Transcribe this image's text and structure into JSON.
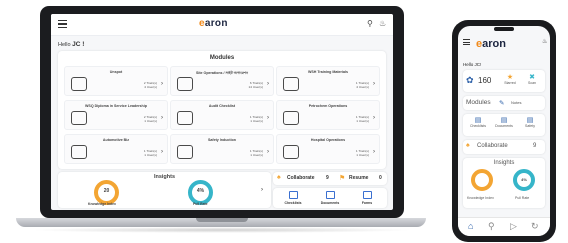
{
  "app": {
    "logo_text": "aron",
    "logo_letter": "e",
    "greeting_prefix": "Hello",
    "user": "JC !"
  },
  "colors": {
    "brand_orange": "#f08a1c",
    "brand_navy": "#1c2540",
    "ring_orange": "#f3a533",
    "ring_teal": "#36b5c9"
  },
  "modules": {
    "title": "Modules",
    "tiles": [
      {
        "name": "Unspot",
        "count1": "2 Train(s)",
        "count2": "4 User(s)",
        "icon": "lamp-icon"
      },
      {
        "name": "Site Operations / সাইট অপারেশন",
        "count1": "6 Train(s)",
        "count2": "14 User(s)",
        "icon": "site-operations-icon"
      },
      {
        "name": "WSH Training Materials",
        "count1": "1 Train(s)",
        "count2": "4 User(s)",
        "icon": "training-icon"
      },
      {
        "name": "WSQ Diploma in Service Leadership",
        "count1": "2 Train(s)",
        "count2": "1 User(s)",
        "icon": "truck-icon"
      },
      {
        "name": "Audit Checklist",
        "count1": "1 Train(s)",
        "count2": "1 User(s)",
        "icon": "checklist-icon"
      },
      {
        "name": "Petrochem Operations",
        "count1": "1 Train(s)",
        "count2": "1 User(s)",
        "icon": "petrochem-icon"
      },
      {
        "name": "Automotive Biz",
        "count1": "1 Train(s)",
        "count2": "1 User(s)",
        "icon": "car-icon"
      },
      {
        "name": "Safety Induction",
        "count1": "1 Train(s)",
        "count2": "1 User(s)",
        "icon": "compass-icon"
      },
      {
        "name": "Hospital Operations",
        "count1": "1 Train(s)",
        "count2": "1 User(s)",
        "icon": "hospital-icon"
      }
    ]
  },
  "insights": {
    "title": "Insights",
    "knowledge_value": "20",
    "knowledge_label": "Knowledge Index",
    "pull_value": "4%",
    "pull_label": "Pull Rate"
  },
  "collaborate": {
    "label": "Collaborate",
    "count": "9",
    "resume_label": "Resume",
    "resume_count": "0"
  },
  "shortcuts": [
    {
      "label": "Checklists",
      "icon": "checklist-icon"
    },
    {
      "label": "Documents",
      "icon": "documents-icon"
    },
    {
      "label": "Forms",
      "icon": "forms-icon"
    }
  ],
  "phone": {
    "greeting": "Hello JC!",
    "stat_value": "160",
    "stats": [
      {
        "label": "Starred"
      },
      {
        "label": "Scan"
      }
    ],
    "modules_label": "Modules",
    "notes_label": "Notes",
    "tiles": [
      {
        "label": "Checklists"
      },
      {
        "label": "Documents"
      },
      {
        "label": "Safety"
      }
    ],
    "collaborate_label": "Collaborate",
    "collaborate_count": "9",
    "insights_title": "Insights",
    "knowledge_label": "Knowledge Index",
    "pull_label": "Pull Rate",
    "pull_value": "4%"
  }
}
